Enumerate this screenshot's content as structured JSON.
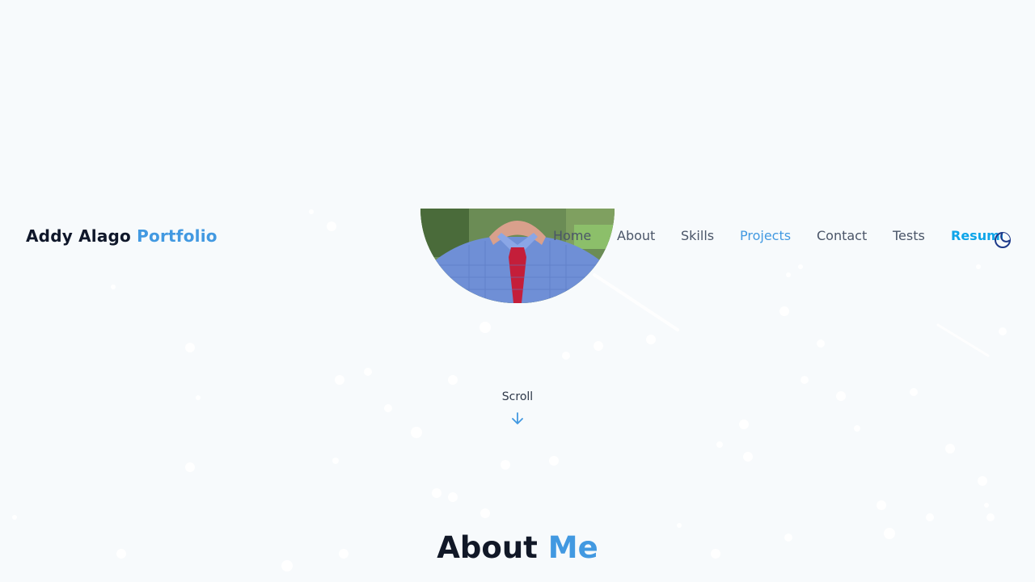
{
  "brand": {
    "name": "Addy Alago",
    "suffix": "Portfolio"
  },
  "nav": {
    "items": [
      "Home",
      "About",
      "Skills",
      "Projects",
      "Contact",
      "Tests"
    ],
    "active": "Projects",
    "resume": "Resume"
  },
  "theme_toggle": {
    "icon": "moon-icon"
  },
  "hero": {
    "image": "profile-photo"
  },
  "scroll": {
    "label": "Scroll",
    "icon": "arrow-down-icon"
  },
  "about": {
    "title": "About",
    "title_accent": "Me"
  },
  "colors": {
    "accent": "#4299e1",
    "resume": "#0ea5e9",
    "text": "#4a5568",
    "heading": "#111827",
    "background": "#f7fafc"
  }
}
